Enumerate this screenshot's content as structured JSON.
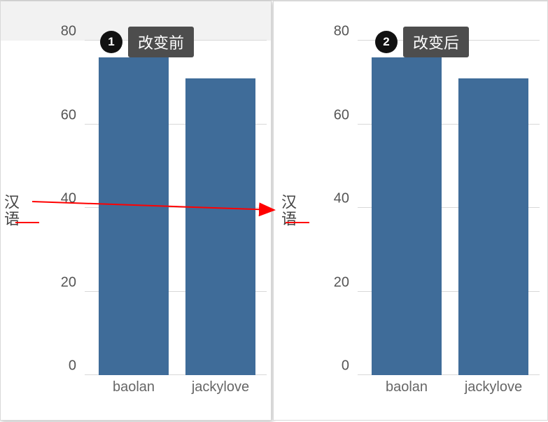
{
  "annotations": {
    "badge_left_num": "1",
    "badge_left_text": "改变前",
    "badge_right_num": "2",
    "badge_right_text": "改变后"
  },
  "chart_data": [
    {
      "type": "bar",
      "title": "改变前",
      "categories": [
        "baolan",
        "jackylove"
      ],
      "values": [
        76,
        71
      ],
      "ylabel": "汉语",
      "ylim": [
        0,
        80
      ],
      "yticks": [
        0,
        20,
        40,
        60,
        80
      ]
    },
    {
      "type": "bar",
      "title": "改变后",
      "categories": [
        "baolan",
        "jackylove"
      ],
      "values": [
        76,
        71
      ],
      "ylabel": "汉语",
      "ylim": [
        0,
        80
      ],
      "yticks": [
        0,
        20,
        40,
        60,
        80
      ]
    }
  ],
  "ticks": {
    "t0": "0",
    "t20": "20",
    "t40": "40",
    "t60": "60",
    "t80": "80"
  },
  "xlabels": {
    "c0": "baolan",
    "c1": "jackylove"
  },
  "ylabel": "汉语"
}
